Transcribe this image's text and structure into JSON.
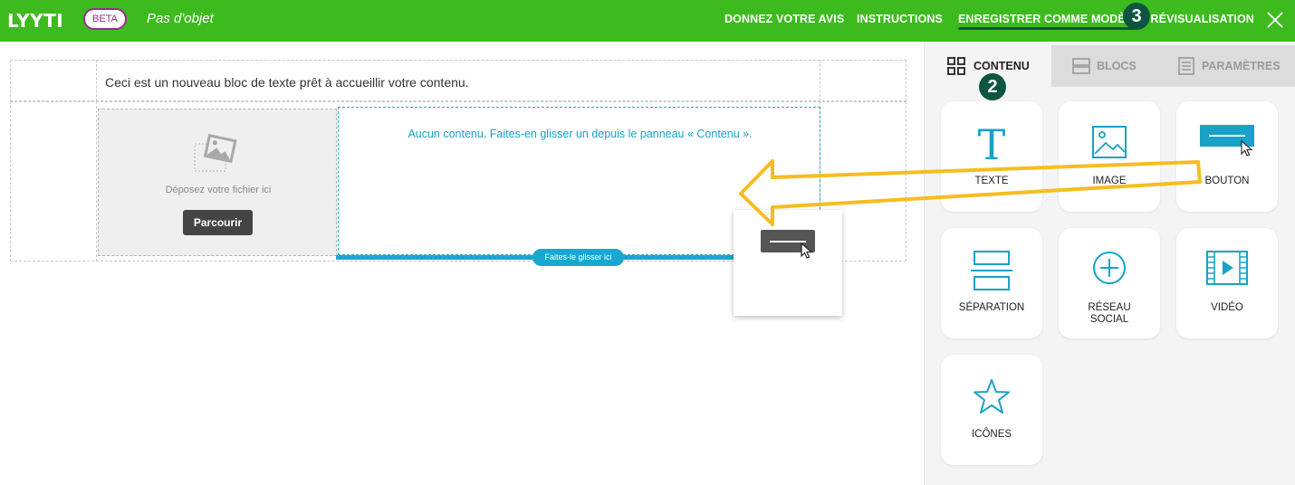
{
  "topbar": {
    "logo": "LYYTI",
    "beta": "BETA",
    "subject": "Pas d'objet",
    "nav": {
      "feedback": "DONNEZ VOTRE AVIS",
      "instructions": "INSTRUCTIONS",
      "save_template": "ENREGISTRER COMME MODÈLE",
      "preview": "PRÉVISUALISATION"
    },
    "step3": "3"
  },
  "canvas": {
    "text_block": "Ceci est un nouveau bloc de texte prêt à accueillir votre contenu.",
    "drop_file": "Déposez votre fichier ici",
    "browse": "Parcourir",
    "empty_column": "Aucun contenu. Faites-en glisser un depuis le panneau « Contenu ».",
    "drop_here": "Faites-le glisser ici"
  },
  "panel": {
    "tabs": {
      "content": "CONTENU",
      "blocks": "BLOCS",
      "settings": "PARAMÈTRES"
    },
    "step2": "2",
    "items": {
      "text": "TEXTE",
      "image": "IMAGE",
      "button": "BOUTON",
      "separator": "SÉPARATION",
      "social_line1": "RÉSEAU",
      "social_line2": "SOCIAL",
      "video": "VIDÉO",
      "icons": "ICÔNES"
    }
  },
  "colors": {
    "brand_green": "#3dbb1e",
    "accent_blue": "#1aa7cf",
    "annotation_dark": "#0e5540",
    "annotation_arrow": "#f5bd1f"
  }
}
